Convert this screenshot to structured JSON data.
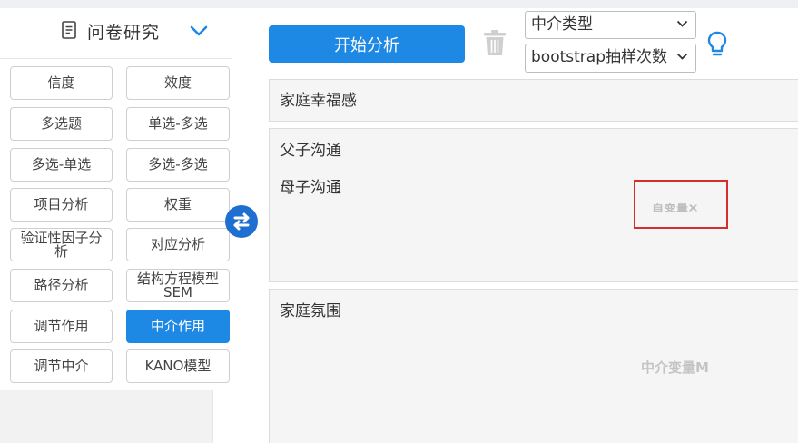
{
  "panel": {
    "title": "问卷研究",
    "methods": [
      {
        "label": "信度",
        "active": false
      },
      {
        "label": "效度",
        "active": false
      },
      {
        "label": "多选题",
        "active": false
      },
      {
        "label": "单选-多选",
        "active": false
      },
      {
        "label": "多选-单选",
        "active": false
      },
      {
        "label": "多选-多选",
        "active": false
      },
      {
        "label": "项目分析",
        "active": false
      },
      {
        "label": "权重",
        "active": false
      },
      {
        "label": "验证性因子分析",
        "line1": "验证性因子分",
        "line2": "析",
        "active": false
      },
      {
        "label": "对应分析",
        "active": false
      },
      {
        "label": "路径分析",
        "active": false
      },
      {
        "label": "结构方程模型SEM",
        "line1": "结构方程模型",
        "line2": "SEM",
        "active": false
      },
      {
        "label": "调节作用",
        "active": false
      },
      {
        "label": "中介作用",
        "active": true
      },
      {
        "label": "调节中介",
        "active": false
      },
      {
        "label": "KANO模型",
        "active": false
      }
    ]
  },
  "toolbar": {
    "start_label": "开始分析",
    "mediation_type": "中介类型",
    "bootstrap": "bootstrap抽样次数"
  },
  "variables": {
    "y": "家庭幸福感",
    "x": [
      "父子沟通",
      "母子沟通"
    ],
    "x_hint": "自变量X",
    "m": "家庭氛围",
    "m_hint": "中介变量M"
  },
  "colors": {
    "accent": "#1e88e5",
    "highlight_border": "#d32f2f"
  }
}
